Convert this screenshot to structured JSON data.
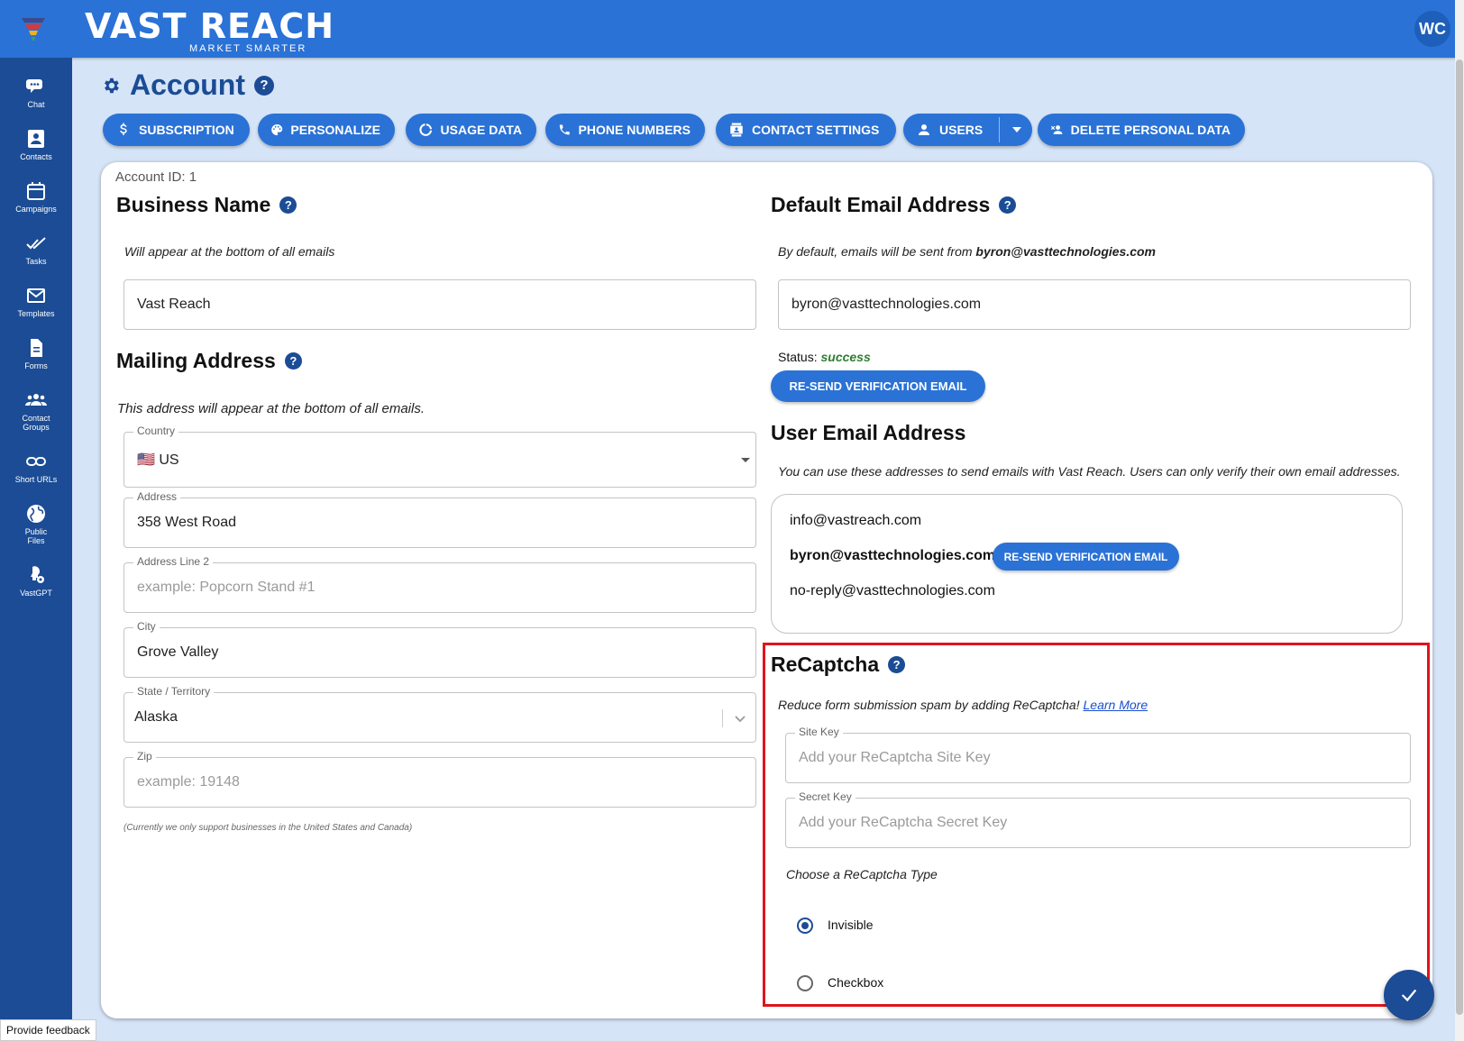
{
  "brand": {
    "name": "VAST REACH",
    "tagline": "MARKET SMARTER"
  },
  "user": {
    "initials": "WC"
  },
  "sidebar": {
    "items": [
      {
        "label": "Chat",
        "icon": "chat-icon"
      },
      {
        "label": "Contacts",
        "icon": "contacts-icon"
      },
      {
        "label": "Campaigns",
        "icon": "campaigns-icon"
      },
      {
        "label": "Tasks",
        "icon": "tasks-icon"
      },
      {
        "label": "Templates",
        "icon": "templates-icon"
      },
      {
        "label": "Forms",
        "icon": "forms-icon"
      },
      {
        "label": "Contact Groups",
        "icon": "contact-groups-icon"
      },
      {
        "label": "Short URLs",
        "icon": "link-icon"
      },
      {
        "label": "Public Files",
        "icon": "globe-icon"
      },
      {
        "label": "VastGPT",
        "icon": "vastgpt-icon"
      }
    ]
  },
  "page": {
    "title": "Account"
  },
  "toolbar": {
    "subscription": "SUBSCRIPTION",
    "personalize": "PERSONALIZE",
    "usage_data": "USAGE DATA",
    "phone_numbers": "PHONE NUMBERS",
    "contact_settings": "CONTACT SETTINGS",
    "users": "USERS",
    "delete_personal_data": "DELETE PERSONAL DATA"
  },
  "account": {
    "id_label": "Account ID: 1"
  },
  "business": {
    "heading": "Business Name",
    "note": "Will appear at the bottom of all emails",
    "value": "Vast Reach"
  },
  "mailing": {
    "heading": "Mailing Address",
    "note": "This address will appear at the bottom of all emails.",
    "country_label": "Country",
    "country_flag": "🇺🇸",
    "country_value": "US",
    "address_label": "Address",
    "address_value": "358 West Road",
    "address2_label": "Address Line 2",
    "address2_placeholder": "example:  Popcorn Stand #1",
    "city_label": "City",
    "city_value": "Grove Valley",
    "state_label": "State / Territory",
    "state_value": "Alaska",
    "zip_label": "Zip",
    "zip_placeholder": "example: 19148",
    "support_note": "(Currently we only support businesses in the United States and Canada)"
  },
  "default_email": {
    "heading": "Default Email Address",
    "note_prefix": "By default, emails will be sent from ",
    "note_email": "byron@vasttechnologies.com",
    "value": "byron@vasttechnologies.com",
    "status_label": "Status:",
    "status_value": "success",
    "resend_label": "RE-SEND VERIFICATION EMAIL"
  },
  "user_email": {
    "heading": "User Email Address",
    "note": "You can use these addresses to send emails with Vast Reach. Users can only verify their own email addresses.",
    "emails": [
      "info@vastreach.com",
      "byron@vasttechnologies.com",
      "no-reply@vasttechnologies.com"
    ],
    "resend_label": "RE-SEND VERIFICATION EMAIL"
  },
  "recaptcha": {
    "heading": "ReCaptcha",
    "note": "Reduce form submission spam by adding ReCaptcha! ",
    "learn_more": "Learn More",
    "site_key_label": "Site Key",
    "site_key_placeholder": "Add your ReCaptcha Site Key",
    "secret_key_label": "Secret Key",
    "secret_key_placeholder": "Add your ReCaptcha Secret Key",
    "type_label": "Choose a ReCaptcha Type",
    "options": [
      "Invisible",
      "Checkbox"
    ],
    "selected": "Invisible"
  },
  "feedback": {
    "label": "Provide feedback"
  },
  "colors": {
    "primary": "#2a72d6",
    "sidebar": "#1b4c95",
    "highlight": "#e0141c",
    "success": "#2e7d32"
  }
}
